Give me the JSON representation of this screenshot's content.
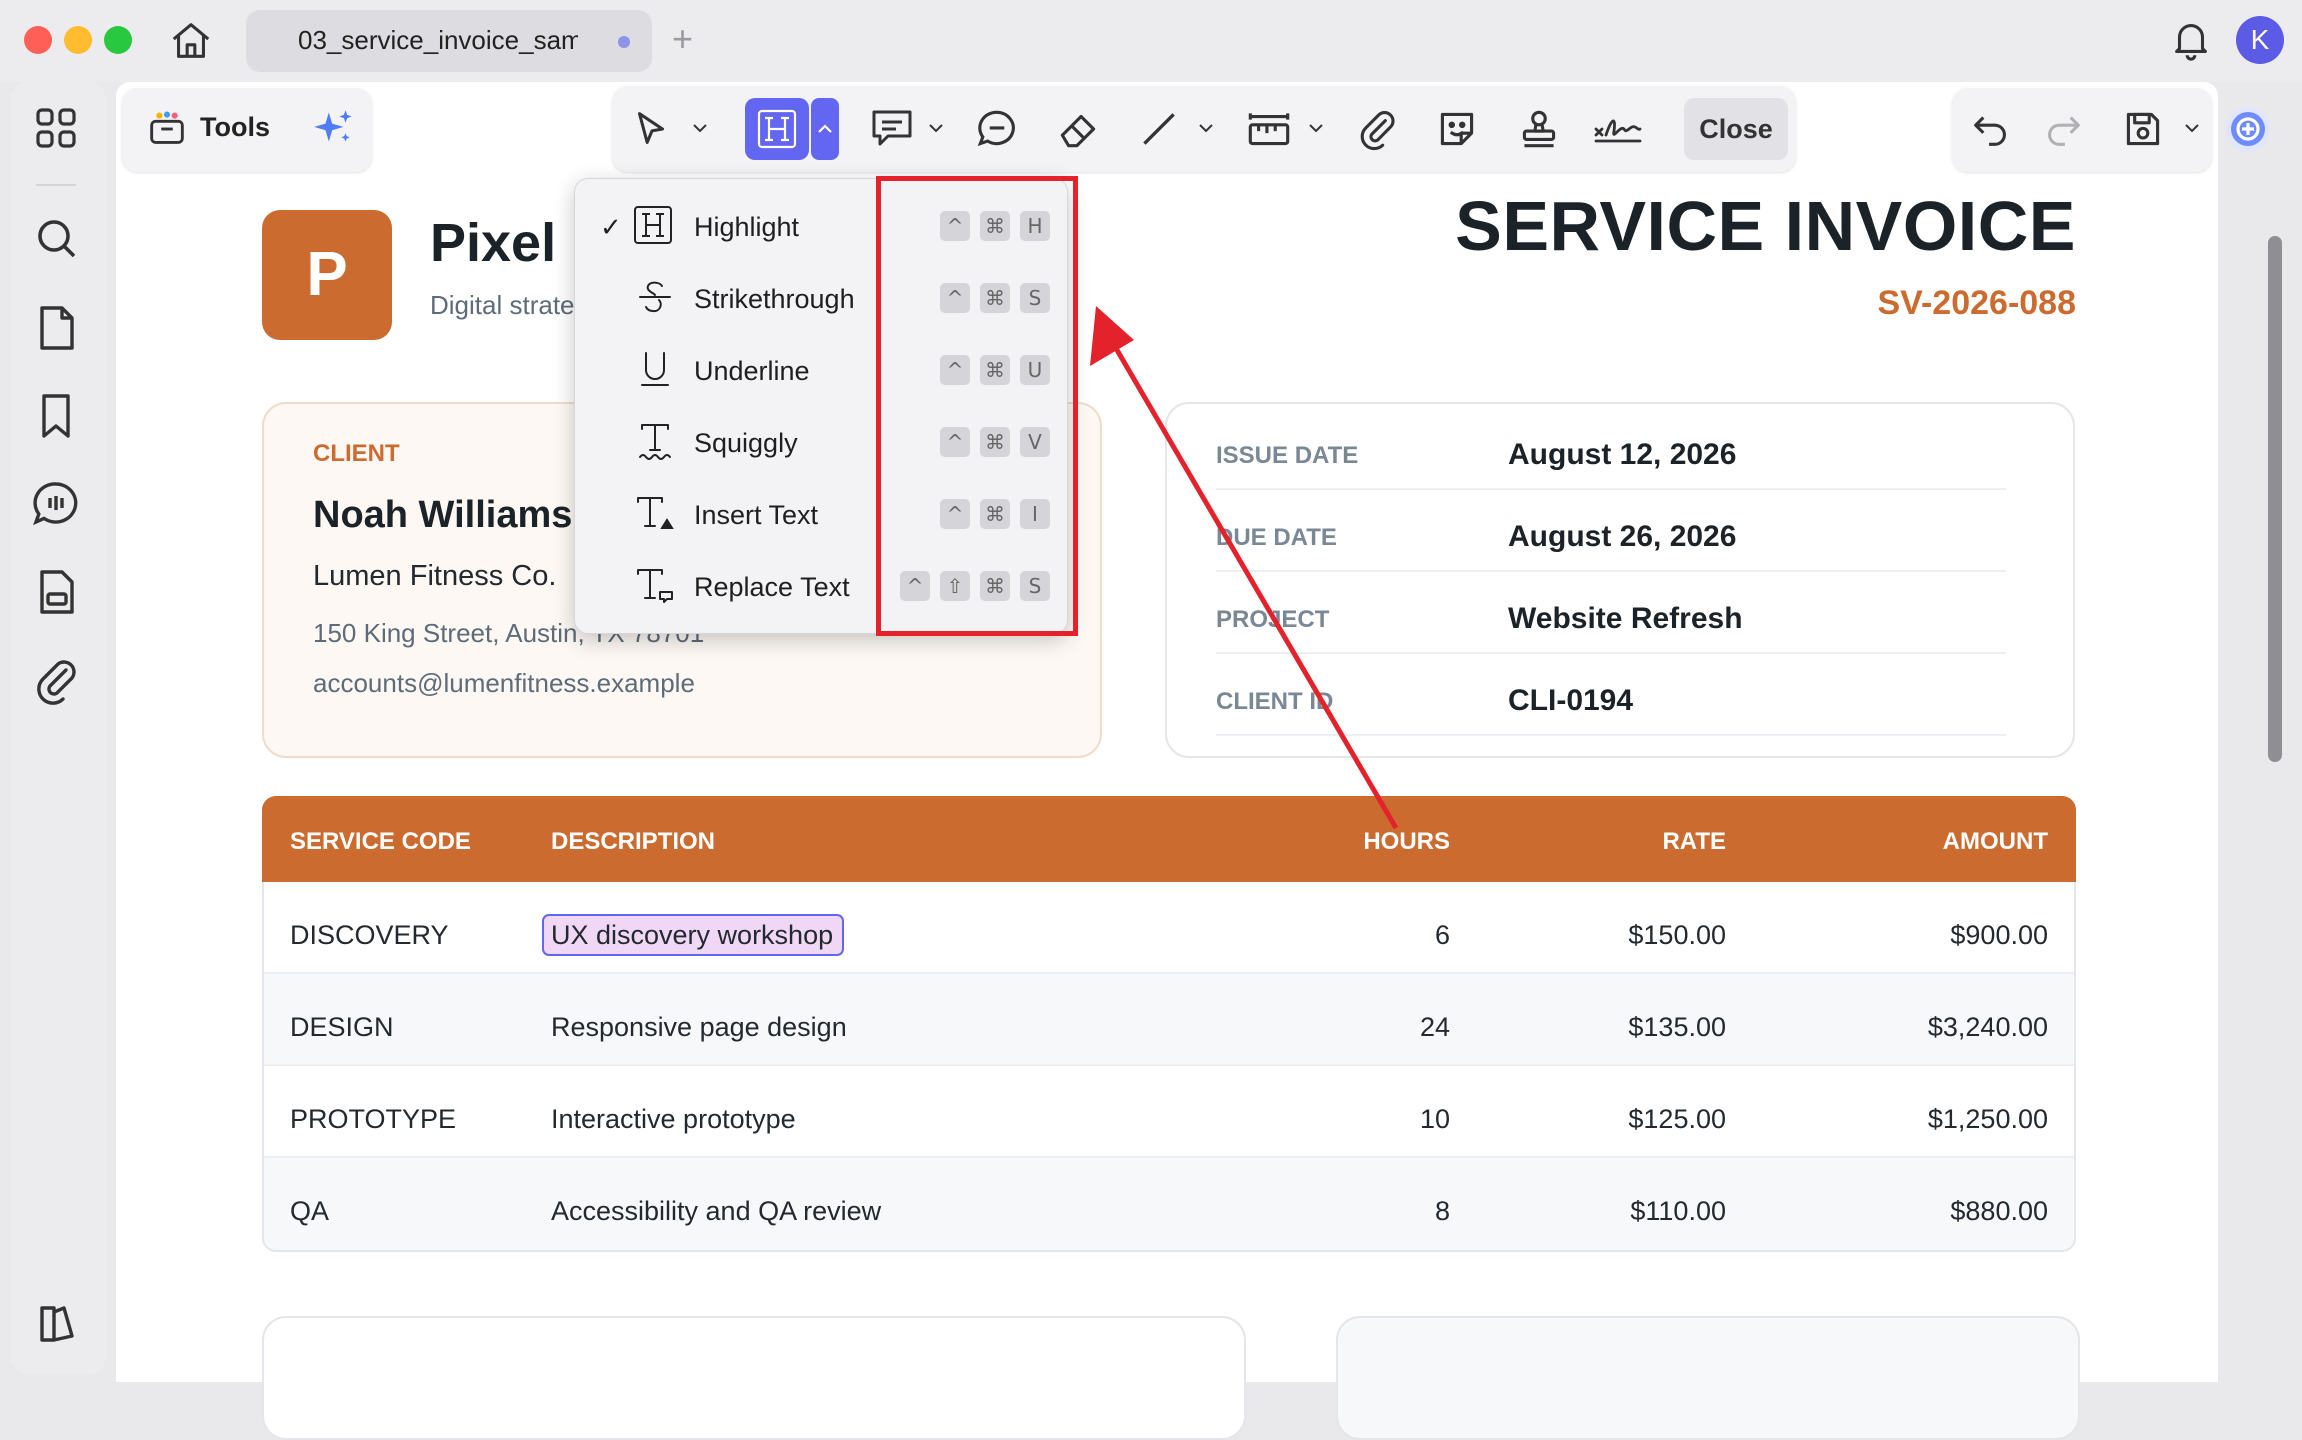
{
  "window": {
    "tab_title": "03_service_invoice_sam",
    "new_tab": "+",
    "avatar_letter": "K"
  },
  "toolbar": {
    "tools_label": "Tools",
    "close_label": "Close"
  },
  "highlight_menu": {
    "items": [
      {
        "label": "Highlight",
        "checked": true,
        "icon": "highlight-icon",
        "shortcut": [
          "^",
          "⌘",
          "H"
        ]
      },
      {
        "label": "Strikethrough",
        "checked": false,
        "icon": "strikethrough-icon",
        "shortcut": [
          "^",
          "⌘",
          "S"
        ]
      },
      {
        "label": "Underline",
        "checked": false,
        "icon": "underline-icon",
        "shortcut": [
          "^",
          "⌘",
          "U"
        ]
      },
      {
        "label": "Squiggly",
        "checked": false,
        "icon": "squiggly-icon",
        "shortcut": [
          "^",
          "⌘",
          "V"
        ]
      },
      {
        "label": "Insert Text",
        "checked": false,
        "icon": "insert-text-icon",
        "shortcut": [
          "^",
          "⌘",
          "I"
        ]
      },
      {
        "label": "Replace Text",
        "checked": false,
        "icon": "replace-text-icon",
        "shortcut": [
          "^",
          "⇧",
          "⌘",
          "S"
        ]
      }
    ]
  },
  "invoice": {
    "logo_letter": "P",
    "company_name": "Pixel",
    "tagline": "Digital strate",
    "title": "SERVICE INVOICE",
    "number": "SV-2026-088",
    "client": {
      "label": "CLIENT",
      "name": "Noah Williams",
      "company": "Lumen Fitness Co.",
      "address": "150 King Street, Austin, TX 78701",
      "email": "accounts@lumenfitness.example"
    },
    "meta": [
      {
        "label": "ISSUE DATE",
        "value": "August 12, 2026"
      },
      {
        "label": "DUE DATE",
        "value": "August 26, 2026"
      },
      {
        "label": "PROJECT",
        "value": "Website Refresh"
      },
      {
        "label": "CLIENT ID",
        "value": "CLI-0194"
      }
    ],
    "table": {
      "headers": [
        "SERVICE CODE",
        "DESCRIPTION",
        "HOURS",
        "RATE",
        "AMOUNT"
      ],
      "rows": [
        {
          "code": "DISCOVERY",
          "description": "UX discovery workshop",
          "hours": "6",
          "rate": "$150.00",
          "amount": "$900.00",
          "highlighted": true
        },
        {
          "code": "DESIGN",
          "description": "Responsive page design",
          "hours": "24",
          "rate": "$135.00",
          "amount": "$3,240.00"
        },
        {
          "code": "PROTOTYPE",
          "description": "Interactive prototype",
          "hours": "10",
          "rate": "$125.00",
          "amount": "$1,250.00"
        },
        {
          "code": "QA",
          "description": "Accessibility and QA review",
          "hours": "8",
          "rate": "$110.00",
          "amount": "$880.00"
        }
      ]
    }
  },
  "colors": {
    "accent": "#6366f1",
    "brand": "#cc6b30",
    "annotation_red": "#e3222b"
  }
}
